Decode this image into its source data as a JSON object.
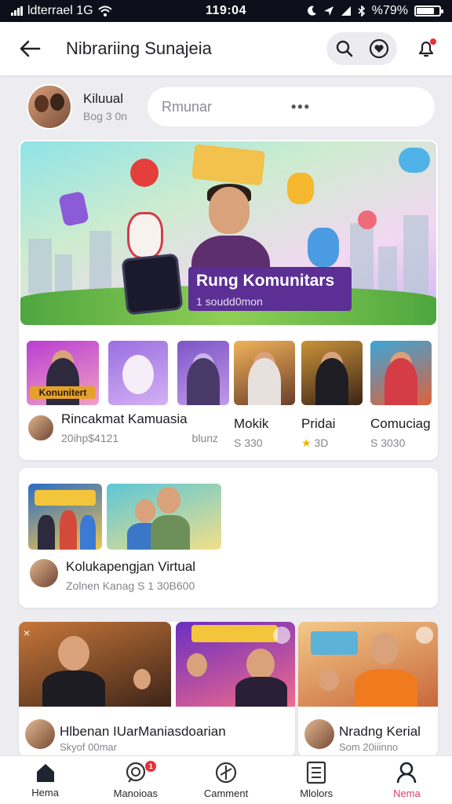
{
  "status_bar": {
    "carrier": "ldterrael 1G",
    "time": "119:04",
    "battery": "%79%"
  },
  "header": {
    "title": "Nibrariing Sunajeia"
  },
  "composer": {
    "user_name": "Kiluual",
    "user_sub": "Bog 3 0n",
    "search_placeholder": "Rmunar",
    "more": "•••"
  },
  "hero": {
    "title": "Rung Komunitars",
    "subtitle": "1 soudd0mon"
  },
  "rooms": [
    {
      "thumb_label": "Konunitert",
      "title": "Rincakmat Kamuasia",
      "sub_left": "20ihp$4121",
      "sub_right": "blunz"
    },
    {
      "title": "Mokik",
      "sub": "S 330"
    },
    {
      "title": "Pridai",
      "sub": "3D"
    },
    {
      "title": "Comuciag",
      "sub": "S 3030"
    }
  ],
  "virtual": {
    "title": "Kolukapengjan Virtual",
    "sub": "Zolnen Kanag S 1 30B600"
  },
  "bottom_cards": [
    {
      "title": "Hlbenan IUarManiasdoarian",
      "sub": "Skyof 00mar"
    },
    {
      "title": "Nradng Kerial",
      "sub": "Som 20iiinno"
    }
  ],
  "nav": [
    {
      "label": "Hema",
      "icon": "home-icon",
      "active": false
    },
    {
      "label": "Manoioas",
      "icon": "chat-icon",
      "badge": "1",
      "active": false
    },
    {
      "label": "Camment",
      "icon": "compass-icon",
      "active": false
    },
    {
      "label": "Mlolors",
      "icon": "list-icon",
      "active": false
    },
    {
      "label": "Nema",
      "icon": "profile-icon",
      "active": true
    }
  ],
  "colors": {
    "accent": "#e03e67",
    "hero_label": "#5b2f93",
    "notification": "#e8323a"
  }
}
